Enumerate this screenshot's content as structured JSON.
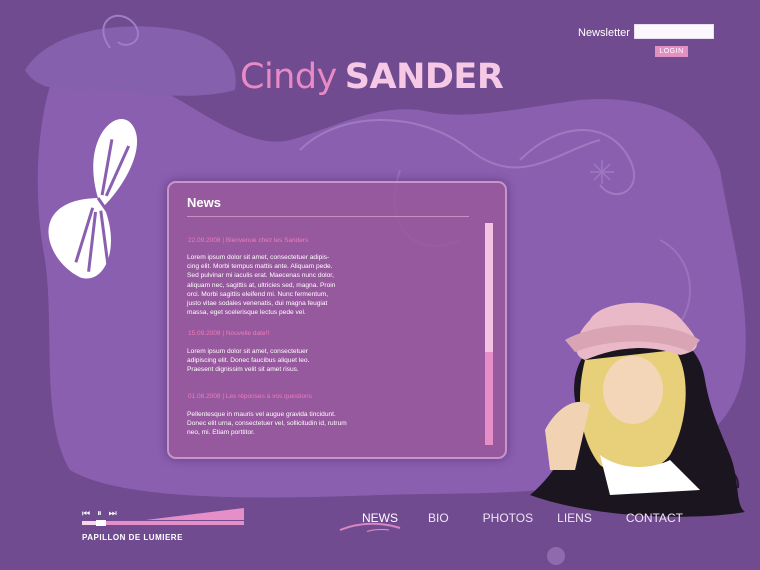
{
  "header": {
    "newsletter_label": "Newsletter",
    "newsletter_value": "",
    "login_label": "LOGIN"
  },
  "logo": {
    "first": "Cindy",
    "last": "SANDER"
  },
  "news": {
    "title": "News",
    "items": [
      {
        "date_line": "22.09.2008  |  Bienvenue chez les Sanders",
        "body": "Lorem ipsum dolor sit amet, consectetuer adipis-\ncing elit. Morbi tempus mattis ante. Aliquam pede.\nSed pulvinar mi iaculis erat. Maecenas nunc dolor,\naliquam nec, sagittis at, ultricies sed, magna. Proin\norci. Morbi sagittis eleifend mi. Nunc fermentum,\njusto vitae sodales venenatis, dui magna feugiat\nmassa, eget scelerisque lectus pede vel."
      },
      {
        "date_line": "15.09.2008  |  Nouvelle date!!",
        "body": "Lorem ipsum dolor sit amet, consectetuer\nadipiscing elit. Donec faucibus aliquet leo.\nPraesent dignissim velit sit amet risus."
      },
      {
        "date_line": "01.08.2008  |  Les réponses à vos questions",
        "body": "Pellentesque in mauris vel augue gravida tincidunt.\nDonec elit urna, consectetuer vel, sollicitudin id, rutrum\nneo, mi. Etiam porttitor."
      }
    ],
    "scroll_position": 0.58
  },
  "player": {
    "prev_icon": "⏮",
    "pause_icon": "⏸",
    "next_icon": "⏭",
    "track_name": "PAPILLON DE LUMIERE",
    "progress": 0.12,
    "volume": 1.0
  },
  "nav": {
    "items": [
      "NEWS",
      "BIO",
      "PHOTOS",
      "LIENS",
      "CONTACT"
    ],
    "active_index": 0
  },
  "colors": {
    "background": "#6f4a8f",
    "accent_pink": "#e98ac6",
    "light_pink": "#f6c8e6",
    "panel": "#9a5898",
    "silhouette": "#8a5fb0"
  },
  "icons": {
    "butterfly": "butterfly-icon",
    "prev": "skip-back-icon",
    "pause": "pause-icon",
    "next": "skip-forward-icon"
  }
}
